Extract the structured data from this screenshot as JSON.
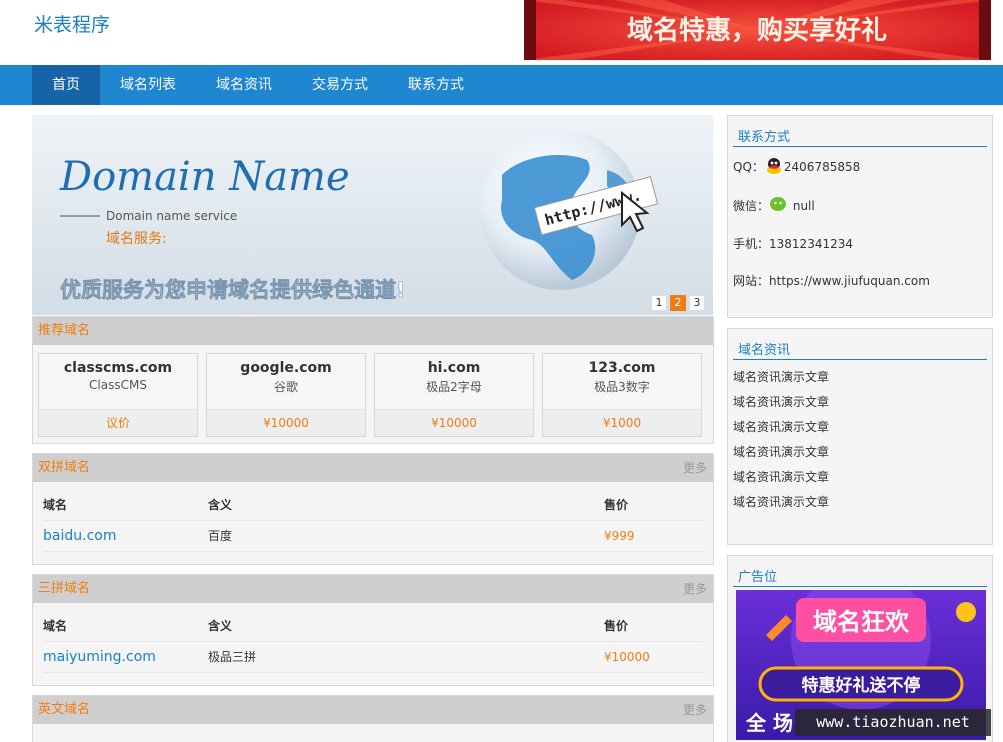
{
  "header": {
    "site_title": "米表程序",
    "top_banner_text": "域名特惠，购买享好礼"
  },
  "nav": {
    "items": [
      "首页",
      "域名列表",
      "域名资讯",
      "交易方式",
      "联系方式"
    ],
    "active_index": 0
  },
  "slider": {
    "title": "Domain Name",
    "subtitle": "Domain name service",
    "cn_subtitle": "域名服务:",
    "slogan": "优质服务为您申请域名提供绿色通道!",
    "sign_text": "http://www.",
    "dots": [
      "1",
      "2",
      "3"
    ],
    "active_dot": 1
  },
  "recommend": {
    "title": "推荐域名",
    "cards": [
      {
        "name": "classcms.com",
        "desc": "ClassCMS",
        "price": "议价"
      },
      {
        "name": "google.com",
        "desc": "谷歌",
        "price": "¥10000"
      },
      {
        "name": "hi.com",
        "desc": "极品2字母",
        "price": "¥10000"
      },
      {
        "name": "123.com",
        "desc": "极品3数字",
        "price": "¥1000"
      }
    ]
  },
  "double": {
    "title": "双拼域名",
    "more": "更多",
    "columns": [
      "域名",
      "含义",
      "售价"
    ],
    "rows": [
      {
        "domain": "baidu.com",
        "meaning": "百度",
        "price": "¥999"
      }
    ]
  },
  "triple": {
    "title": "三拼域名",
    "more": "更多",
    "columns": [
      "域名",
      "含义",
      "售价"
    ],
    "rows": [
      {
        "domain": "maiyuming.com",
        "meaning": "极品三拼",
        "price": "¥10000"
      }
    ]
  },
  "english": {
    "title": "英文域名",
    "more": "更多"
  },
  "contact": {
    "title": "联系方式",
    "qq_label": "QQ：",
    "qq_value": "2406785858",
    "wechat_label": "微信：",
    "wechat_value": "null",
    "phone_label": "手机：",
    "phone_value": "13812341234",
    "site_label": "网站：",
    "site_value": "https://www.jiufuquan.com"
  },
  "news": {
    "title": "域名资讯",
    "items": [
      "域名资讯演示文章",
      "域名资讯演示文章",
      "域名资讯演示文章",
      "域名资讯演示文章",
      "域名资讯演示文章",
      "域名资讯演示文章"
    ]
  },
  "ad": {
    "title": "广告位",
    "line1": "域名狂欢",
    "line2": "特惠好礼送不停",
    "line3": "全 场"
  },
  "watermark": "www.tiaozhuan.net",
  "colors": {
    "accent_blue": "#1f86d0",
    "nav_active": "#1663a8",
    "orange": "#f07d12",
    "banner_red": "#e8262c"
  }
}
